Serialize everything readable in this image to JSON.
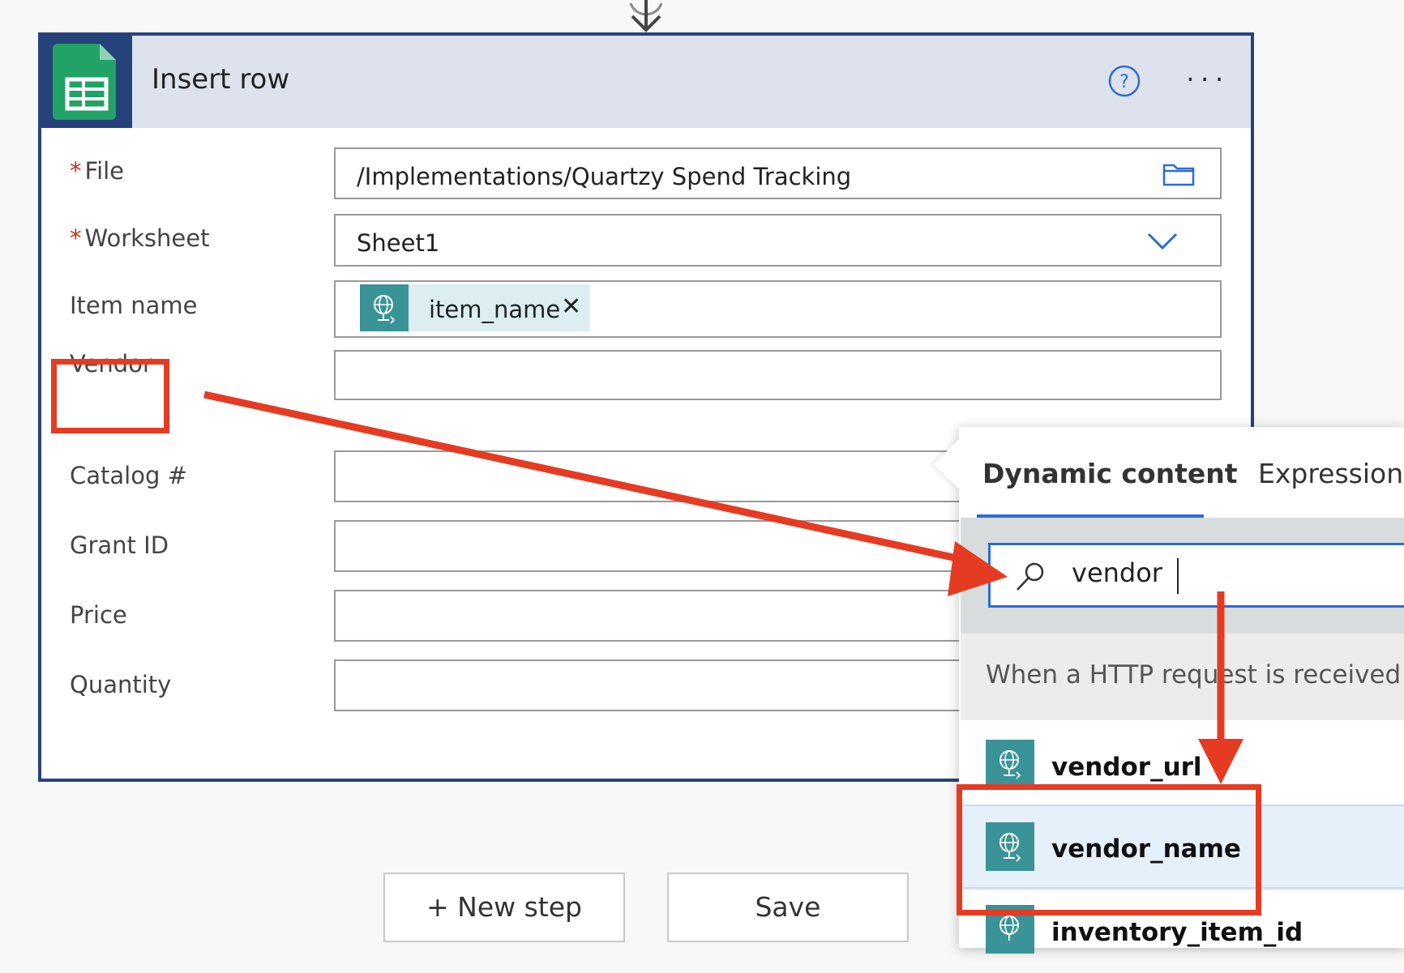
{
  "card": {
    "title": "Insert row",
    "app_icon": "google-sheets-icon",
    "help_icon": "help-circle-icon",
    "more_label": "..."
  },
  "fields": {
    "file": {
      "required_mark": "*",
      "label": "File",
      "value": "/Implementations/Quartzy Spend Tracking",
      "icon": "folder-icon"
    },
    "worksheet": {
      "required_mark": "*",
      "label": "Worksheet",
      "value": "Sheet1",
      "icon": "chevron-down-icon"
    },
    "item_name": {
      "label": "Item name",
      "token": "item_name",
      "token_icon": "http-request-icon"
    },
    "vendor": {
      "label": "Vendor",
      "value": ""
    },
    "catalog": {
      "label": "Catalog #",
      "value": ""
    },
    "grant_id": {
      "label": "Grant ID",
      "value": ""
    },
    "price": {
      "label": "Price",
      "value": ""
    },
    "quantity": {
      "label": "Quantity",
      "value": ""
    }
  },
  "buttons": {
    "new_step": "+ New step",
    "save": "Save"
  },
  "dynamic_panel": {
    "tabs": [
      "Dynamic content",
      "Expression"
    ],
    "active_tab": "Dynamic content",
    "search_value": "vendor",
    "group_title": "When a HTTP request is received",
    "items": [
      {
        "label": "vendor_url",
        "icon": "http-request-icon"
      },
      {
        "label": "vendor_name",
        "icon": "http-request-icon",
        "highlighted": true
      },
      {
        "label": "inventory_item_id",
        "icon": "http-request-icon"
      }
    ]
  },
  "colors": {
    "card_border": "#26427a",
    "header_bg": "#dde2ec",
    "accent_blue": "#2b6bd6",
    "token_teal": "#3a9396",
    "annotation_red": "#e63b23",
    "sheets_green": "#21a366"
  }
}
